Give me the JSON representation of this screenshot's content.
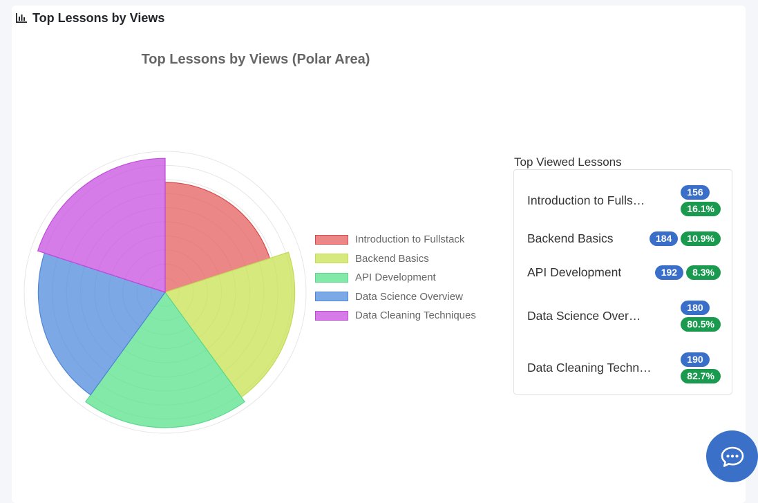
{
  "header": {
    "title": "Top Lessons by Views",
    "icon": "bar-chart-icon"
  },
  "colors": {
    "badge_views": "#3a6fc9",
    "badge_percent": "#1a9a4e",
    "chat_button": "#3a70c8"
  },
  "chart_data": {
    "type": "polarArea",
    "title": "Top Lessons by Views (Polar Area)",
    "categories": [
      "Introduction to Fullstack",
      "Backend Basics",
      "API Development",
      "Data Science Overview",
      "Data Cleaning Techniques"
    ],
    "values": [
      156,
      184,
      192,
      180,
      190
    ],
    "rlim": [
      0,
      200
    ],
    "grid": true,
    "legend": "right",
    "fill_colors": [
      "rgba(230,95,95,0.75)",
      "rgba(200,225,80,0.75)",
      "rgba(90,225,140,0.75)",
      "rgba(80,140,220,0.75)",
      "rgba(200,80,225,0.75)"
    ],
    "border_colors": [
      "#d64a4a",
      "#c5d95a",
      "#59d98c",
      "#4f86d6",
      "#c04ad8"
    ]
  },
  "panel": {
    "title": "Top Viewed Lessons",
    "lessons": [
      {
        "name": "Introduction to Fullstack",
        "views": "156",
        "percent": "16.1%"
      },
      {
        "name": "Backend Basics",
        "views": "184",
        "percent": "10.9%"
      },
      {
        "name": "API Development",
        "views": "192",
        "percent": "8.3%"
      },
      {
        "name": "Data Science Overview",
        "views": "180",
        "percent": "80.5%"
      },
      {
        "name": "Data Cleaning Techniques",
        "views": "190",
        "percent": "82.7%"
      }
    ]
  },
  "chat": {
    "icon": "chat-bubble-icon"
  }
}
